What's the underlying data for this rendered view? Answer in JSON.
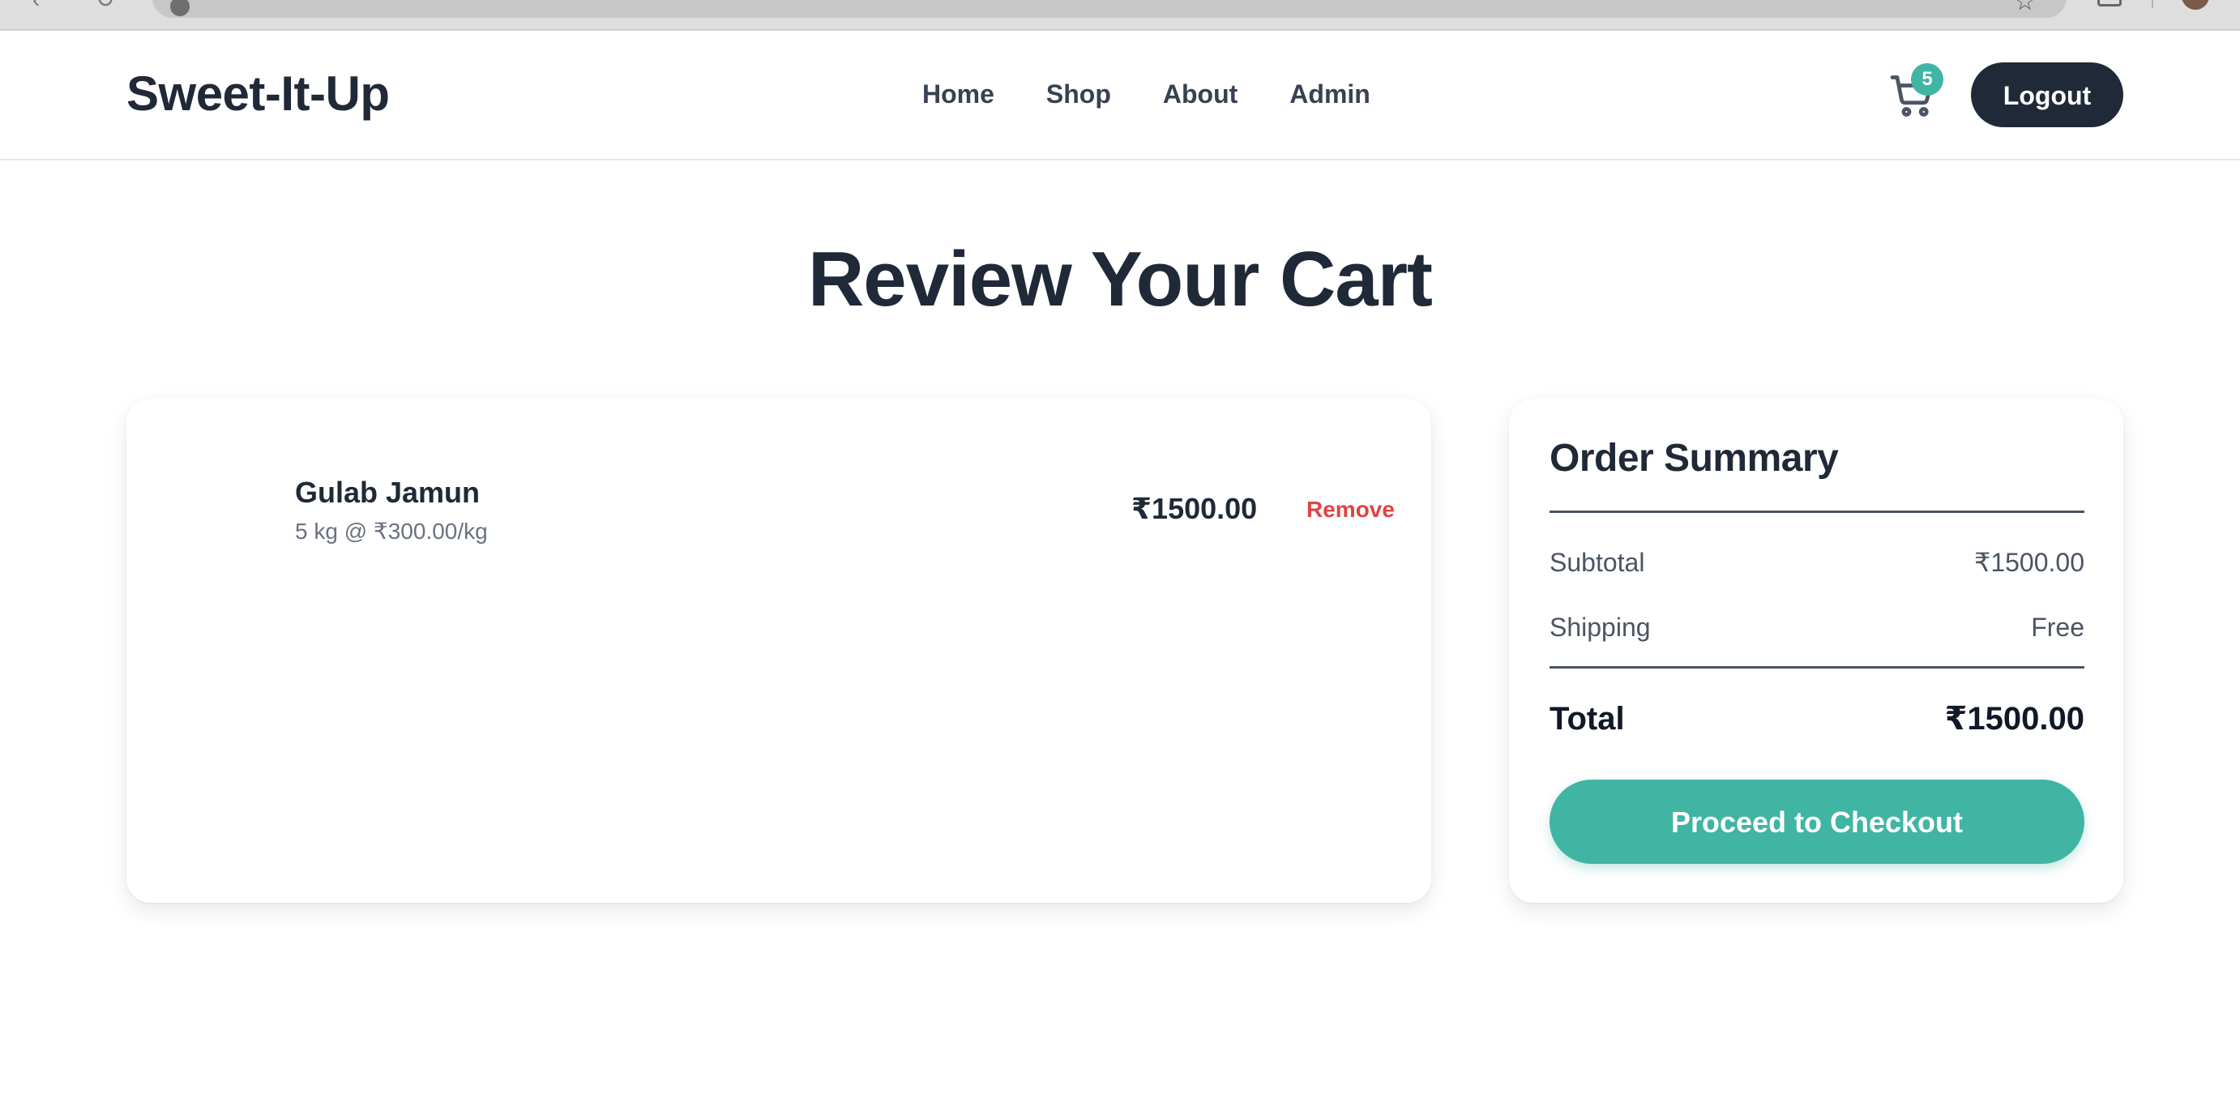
{
  "brand": "Sweet-It-Up",
  "nav": {
    "links": [
      "Home",
      "Shop",
      "About",
      "Admin"
    ],
    "cart_count": "5",
    "logout_label": "Logout"
  },
  "page_title": "Review Your Cart",
  "cart": {
    "items": [
      {
        "name": "Gulab Jamun",
        "detail": "5 kg @ ₹300.00/kg",
        "price": "₹1500.00",
        "remove_label": "Remove"
      }
    ]
  },
  "summary": {
    "title": "Order Summary",
    "subtotal_label": "Subtotal",
    "subtotal_value": "₹1500.00",
    "shipping_label": "Shipping",
    "shipping_value": "Free",
    "total_label": "Total",
    "total_value": "₹1500.00",
    "checkout_label": "Proceed to Checkout"
  },
  "colors": {
    "accent": "#40b5a4",
    "dark": "#1f2937",
    "remove": "#e04343"
  },
  "icons": [
    "back-arrow-icon",
    "reload-icon",
    "site-info-icon",
    "bookmark-star-icon",
    "extensions-icon",
    "profile-avatar",
    "cart-icon"
  ]
}
